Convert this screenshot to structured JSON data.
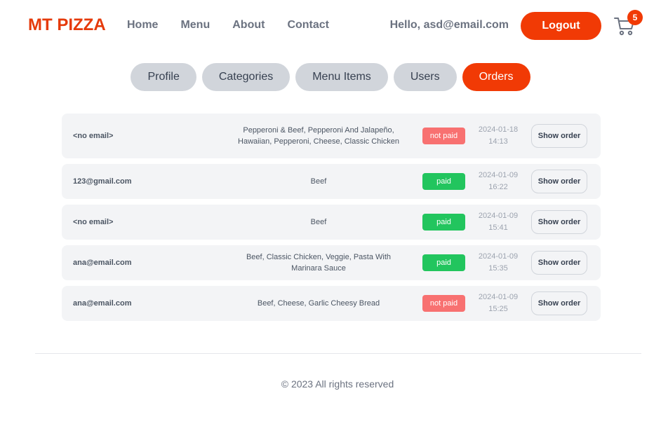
{
  "header": {
    "logo": "MT PIZZA",
    "nav": [
      "Home",
      "Menu",
      "About",
      "Contact"
    ],
    "greeting": "Hello, asd@email.com",
    "logout_label": "Logout",
    "cart_count": "5",
    "accent_color": "#f13a05"
  },
  "tabs": [
    {
      "label": "Profile",
      "active": false
    },
    {
      "label": "Categories",
      "active": false
    },
    {
      "label": "Menu Items",
      "active": false
    },
    {
      "label": "Users",
      "active": false
    },
    {
      "label": "Orders",
      "active": true
    }
  ],
  "orders": [
    {
      "email": "<no email>",
      "items": "Pepperoni & Beef, Pepperoni And Jalapeño, Hawaiian, Pepperoni, Cheese, Classic Chicken",
      "status": "not paid",
      "date": "2024-01-18",
      "time": "14:13",
      "button": "Show order"
    },
    {
      "email": "123@gmail.com",
      "items": "Beef",
      "status": "paid",
      "date": "2024-01-09",
      "time": "16:22",
      "button": "Show order"
    },
    {
      "email": "<no email>",
      "items": "Beef",
      "status": "paid",
      "date": "2024-01-09",
      "time": "15:41",
      "button": "Show order"
    },
    {
      "email": "ana@email.com",
      "items": "Beef, Classic Chicken, Veggie, Pasta With Marinara Sauce",
      "status": "paid",
      "date": "2024-01-09",
      "time": "15:35",
      "button": "Show order"
    },
    {
      "email": "ana@email.com",
      "items": "Beef, Cheese, Garlic Cheesy Bread",
      "status": "not paid",
      "date": "2024-01-09",
      "time": "15:25",
      "button": "Show order"
    }
  ],
  "footer": {
    "copyright": "© 2023 All rights reserved"
  }
}
